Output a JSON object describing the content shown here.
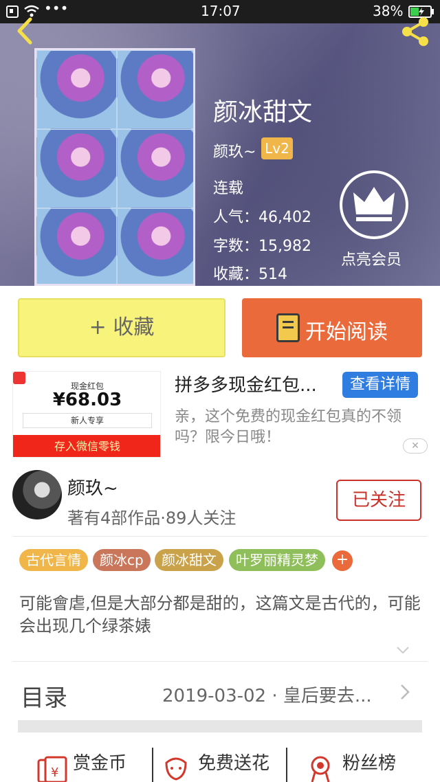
{
  "status_bar": {
    "time": "17:07",
    "battery": "38%"
  },
  "book": {
    "title": "颜冰甜文",
    "author": "颜玖~",
    "level": "Lv2",
    "status": "连载",
    "popularity": "人气：46,402",
    "word_count": "字数：15,982",
    "favorites": "收藏：514"
  },
  "vip": {
    "label": "点亮会员"
  },
  "actions": {
    "favorite_label": "+ 收藏",
    "read_label": "开始阅读"
  },
  "ad": {
    "image_caption": "现金红包",
    "amount": "¥68.03",
    "newbie": "新人专享",
    "deposit": "存入微信零钱",
    "title": "拼多多现金红包...",
    "button": "查看详情",
    "description": "亲，这个免费的现金红包真的不领吗？限今日哦！"
  },
  "author_card": {
    "name": "颜玖~",
    "meta": "著有4部作品·89人关注",
    "follow_label": "已关注"
  },
  "tags": [
    {
      "label": "古代言情",
      "color": "#f0b64a"
    },
    {
      "label": "颜冰cp",
      "color": "#c9765a"
    },
    {
      "label": "颜冰甜文",
      "color": "#c9a24a"
    },
    {
      "label": "叶罗丽精灵梦",
      "color": "#8fbf5a"
    }
  ],
  "tag_more": "+",
  "description": "可能會虐,但是大部分都是甜的，这篇文是古代的，可能会出现几个绿茶婊",
  "toc": {
    "label": "目录",
    "latest": "2019-03-02 · 皇后要去..."
  },
  "bottom": [
    {
      "label": "赏金币"
    },
    {
      "label": "免费送花"
    },
    {
      "label": "粉丝榜"
    }
  ],
  "colors": {
    "accent_orange": "#ea6a3c",
    "fav_yellow": "#f8f37b",
    "follow_red": "#c8322a",
    "ad_blue": "#2f7de0"
  }
}
